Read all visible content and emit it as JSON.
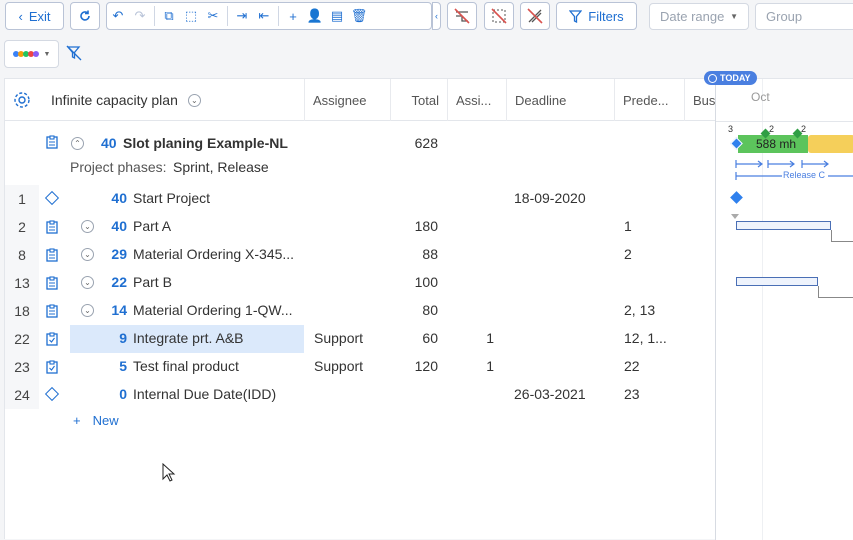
{
  "toolbar": {
    "exit_label": "Exit",
    "filters_label": "Filters",
    "date_range_placeholder": "Date range",
    "group_placeholder": "Group"
  },
  "header": {
    "plan_name": "Infinite capacity plan",
    "col_assignee": "Assignee",
    "col_total": "Total",
    "col_assigned": "Assi...",
    "col_deadline": "Deadline",
    "col_predecessors": "Prede...",
    "col_bus": "Bus"
  },
  "project": {
    "num": "40",
    "name": "Slot planing Example-NL",
    "total": "628",
    "phases_label": "Project phases:",
    "phases_value": "Sprint, Release"
  },
  "rows": [
    {
      "id": "1",
      "num": "40",
      "name": "Start Project",
      "assignee": "",
      "total": "",
      "assigned": "",
      "deadline": "18-09-2020",
      "pred": ""
    },
    {
      "id": "2",
      "num": "40",
      "name": "Part A",
      "assignee": "",
      "total": "180",
      "assigned": "",
      "deadline": "",
      "pred": "1"
    },
    {
      "id": "8",
      "num": "29",
      "name": "Material Ordering X-345...",
      "assignee": "",
      "total": "88",
      "assigned": "",
      "deadline": "",
      "pred": "2"
    },
    {
      "id": "13",
      "num": "22",
      "name": "Part B",
      "assignee": "",
      "total": "100",
      "assigned": "",
      "deadline": "",
      "pred": ""
    },
    {
      "id": "18",
      "num": "14",
      "name": "Material Ordering 1-QW...",
      "assignee": "",
      "total": "80",
      "assigned": "",
      "deadline": "",
      "pred": "2, 13"
    },
    {
      "id": "22",
      "num": "9",
      "name": "Integrate prt. A&B",
      "assignee": "Support",
      "total": "60",
      "assigned": "1",
      "deadline": "",
      "pred": "12, 1..."
    },
    {
      "id": "23",
      "num": "5",
      "name": "Test final product",
      "assignee": "Support",
      "total": "120",
      "assigned": "1",
      "deadline": "",
      "pred": "22"
    },
    {
      "id": "24",
      "num": "0",
      "name": "Internal Due Date(IDD)",
      "assignee": "",
      "total": "",
      "assigned": "",
      "deadline": "26-03-2021",
      "pred": "23"
    }
  ],
  "new_label": "New",
  "gantt": {
    "today_label": "TODAY",
    "month": "Oct",
    "bar_label": "588 mh",
    "marker_3": "3",
    "marker_2a": "2",
    "marker_2b": "2",
    "release_label": "Release C"
  },
  "colors": {
    "accent": "#1f6fd1",
    "selected_row": "#dbe9fb",
    "green_bar": "#5cc45c",
    "yellow_bar": "#f5cf5a"
  }
}
